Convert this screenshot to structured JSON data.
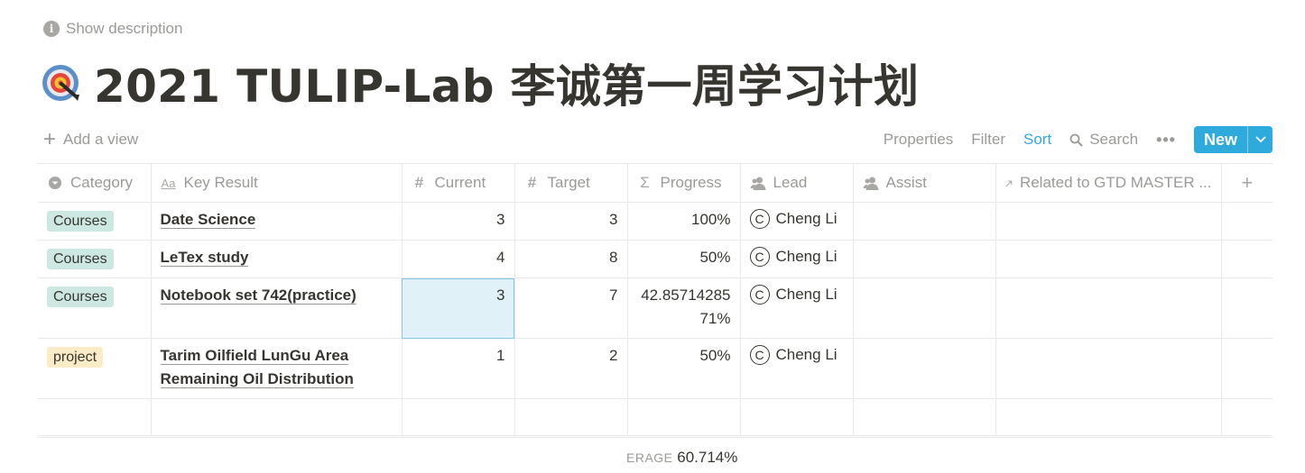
{
  "description_toggle": "Show description",
  "page": {
    "title": "2021 TULIP-Lab 李诚第一周学习计划",
    "icon": "target-icon"
  },
  "toolbar": {
    "add_view": "Add a view",
    "properties": "Properties",
    "filter": "Filter",
    "sort": "Sort",
    "search": "Search",
    "more": "•••",
    "new": "New"
  },
  "columns": [
    {
      "label": "Category",
      "icon": "select-icon"
    },
    {
      "label": "Key Result",
      "icon": "title-icon"
    },
    {
      "label": "Current",
      "icon": "number-icon"
    },
    {
      "label": "Target",
      "icon": "number-icon"
    },
    {
      "label": "Progress",
      "icon": "formula-icon"
    },
    {
      "label": "Lead",
      "icon": "person-icon"
    },
    {
      "label": "Assist",
      "icon": "person-icon"
    },
    {
      "label": "Related to GTD MASTER ...",
      "icon": "relation-icon"
    },
    {
      "label": "+",
      "icon": "add-column-icon"
    }
  ],
  "rows": [
    {
      "category": "Courses",
      "key_result": "Date Science",
      "current": "3",
      "target": "3",
      "progress": "100%",
      "lead_initial": "C",
      "lead": "Cheng Li"
    },
    {
      "category": "Courses",
      "key_result": "LeTex study",
      "current": "4",
      "target": "8",
      "progress": "50%",
      "lead_initial": "C",
      "lead": "Cheng Li"
    },
    {
      "category": "Courses",
      "key_result": "Notebook set 742(practice)",
      "current": "3",
      "target": "7",
      "progress": "42.85714285 71%",
      "lead_initial": "C",
      "lead": "Cheng Li"
    },
    {
      "category": "project",
      "key_result": "Tarim Oilfield LunGu Area Remaining Oil Distribution",
      "current": "1",
      "target": "2",
      "progress": "50%",
      "lead_initial": "C",
      "lead": "Cheng Li"
    }
  ],
  "footer": {
    "calc_label": "ERAGE",
    "calc_value": "60.714%"
  },
  "colors": {
    "accent": "#2eaadc",
    "courses_tag": "#cde8e2",
    "project_tag": "#fbecc8",
    "selected_cell": "#e1f1f8"
  }
}
